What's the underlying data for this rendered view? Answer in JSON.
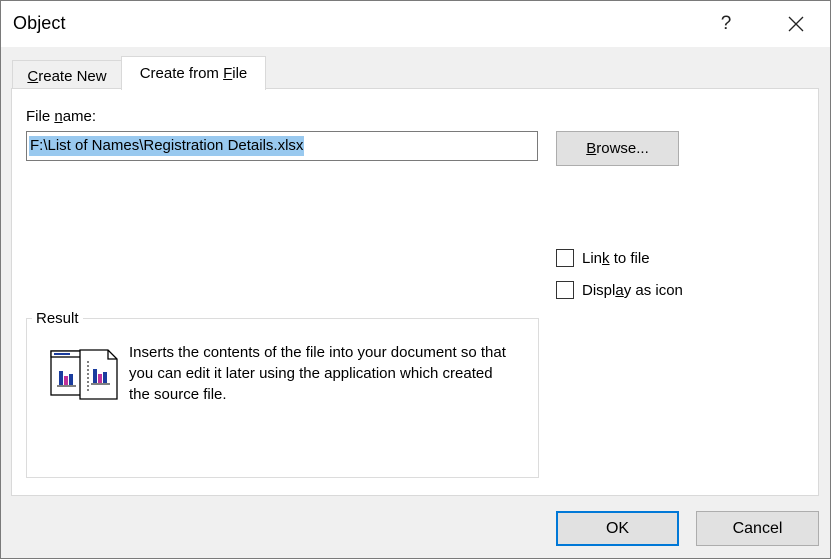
{
  "window": {
    "title": "Object",
    "help_symbol": "?",
    "close_icon": "close-icon"
  },
  "tabs": [
    {
      "prefix": "",
      "accel": "C",
      "suffix": "reate New",
      "active": false
    },
    {
      "prefix": "Create from ",
      "accel": "F",
      "suffix": "ile",
      "active": true
    }
  ],
  "file": {
    "label_prefix": "File ",
    "label_accel": "n",
    "label_suffix": "ame:",
    "value": "F:\\List of Names\\Registration Details.xlsx"
  },
  "browse": {
    "accel": "B",
    "suffix": "rowse..."
  },
  "options": {
    "link": {
      "prefix": "Lin",
      "accel": "k",
      "suffix": " to file",
      "checked": false
    },
    "icon": {
      "prefix": "Displ",
      "accel": "a",
      "suffix": "y as icon",
      "checked": false
    }
  },
  "result": {
    "legend": "Result",
    "line1": "Inserts the contents of the file into your document so that",
    "line2": "you can edit it later using the application which created",
    "line3": "the source file.",
    "icon": "embedded-object-icon"
  },
  "buttons": {
    "ok": "OK",
    "cancel": "Cancel"
  },
  "colors": {
    "selection": "#99c9ef",
    "focus_border": "#0078d7"
  }
}
